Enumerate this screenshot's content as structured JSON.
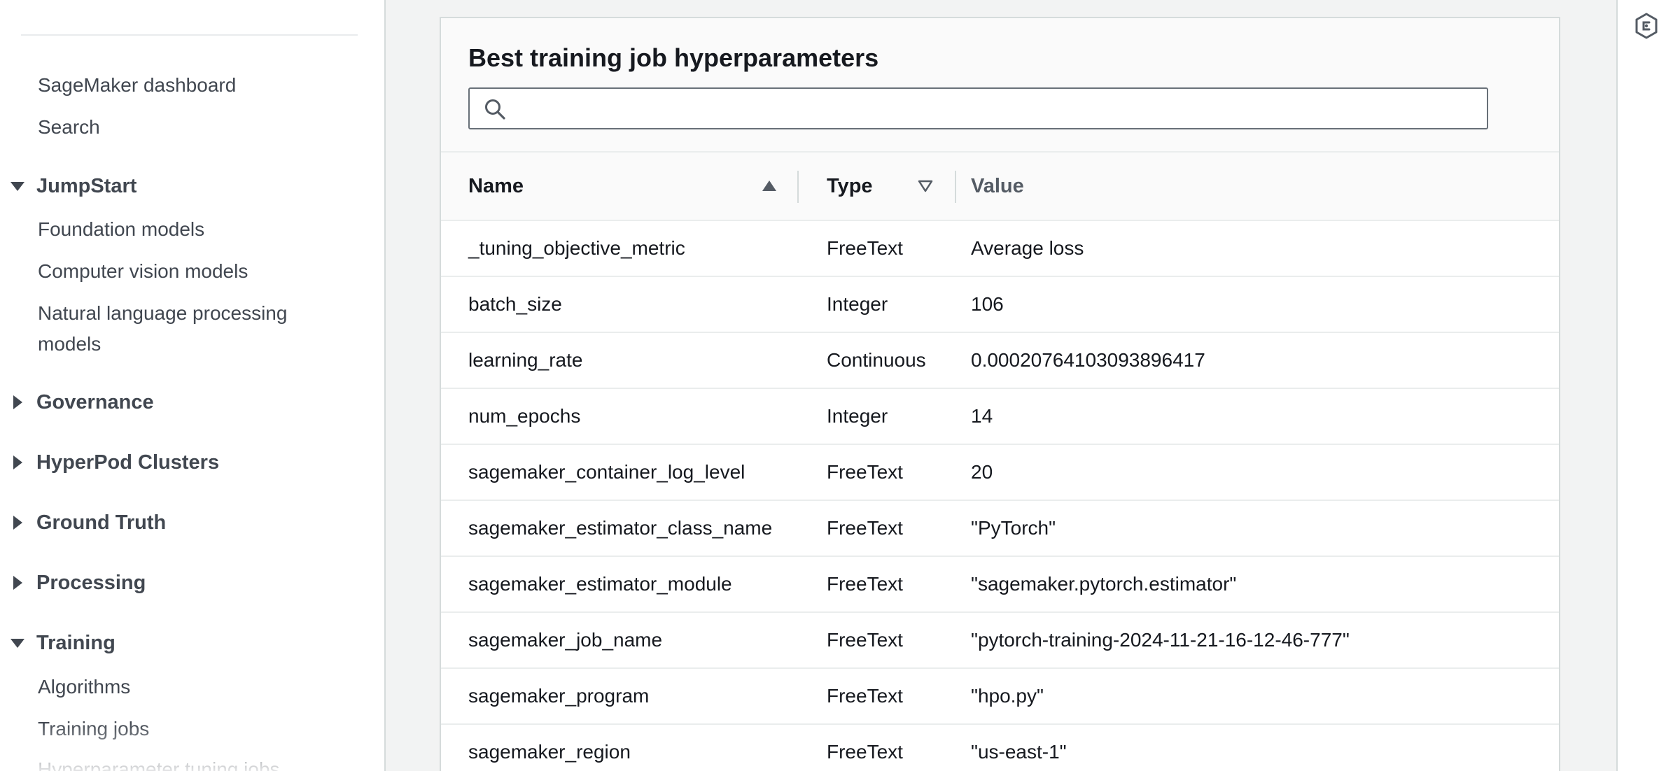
{
  "sidebar": {
    "links_top": [
      {
        "label": "SageMaker dashboard"
      },
      {
        "label": "Search"
      }
    ],
    "jumpstart": {
      "label": "JumpStart",
      "expanded": true,
      "items": [
        "Foundation models",
        "Computer vision models",
        "Natural language processing models"
      ]
    },
    "governance": {
      "label": "Governance",
      "expanded": false
    },
    "hyperpod": {
      "label": "HyperPod Clusters",
      "expanded": false
    },
    "ground_truth": {
      "label": "Ground Truth",
      "expanded": false
    },
    "processing": {
      "label": "Processing",
      "expanded": false
    },
    "training": {
      "label": "Training",
      "expanded": true,
      "items": [
        "Algorithms",
        "Training jobs",
        "Hyperparameter tuning jobs"
      ]
    }
  },
  "panel": {
    "title": "Best training job hyperparameters",
    "search": {
      "value": "",
      "placeholder": ""
    },
    "columns": {
      "name": "Name",
      "type": "Type",
      "value": "Value"
    },
    "sort": {
      "name": "ascending",
      "type": "unsorted"
    },
    "rows": [
      {
        "name": "_tuning_objective_metric",
        "type": "FreeText",
        "value": "Average loss"
      },
      {
        "name": "batch_size",
        "type": "Integer",
        "value": "106"
      },
      {
        "name": "learning_rate",
        "type": "Continuous",
        "value": "0.00020764103093896417"
      },
      {
        "name": "num_epochs",
        "type": "Integer",
        "value": "14"
      },
      {
        "name": "sagemaker_container_log_level",
        "type": "FreeText",
        "value": "20"
      },
      {
        "name": "sagemaker_estimator_class_name",
        "type": "FreeText",
        "value": "\"PyTorch\""
      },
      {
        "name": "sagemaker_estimator_module",
        "type": "FreeText",
        "value": "\"sagemaker.pytorch.estimator\""
      },
      {
        "name": "sagemaker_job_name",
        "type": "FreeText",
        "value": "\"pytorch-training-2024-11-21-16-12-46-777\""
      },
      {
        "name": "sagemaker_program",
        "type": "FreeText",
        "value": "\"hpo.py\""
      },
      {
        "name": "sagemaker_region",
        "type": "FreeText",
        "value": "\"us-east-1\""
      }
    ]
  },
  "colors": {
    "sidebar_text": "#414750",
    "border": "#d5dbdb",
    "header_bg": "#fafafa"
  },
  "icons": {
    "search": "search-icon",
    "sort_asc": "caret-up-filled-icon",
    "sort_none": "caret-down-outline-icon",
    "expanded": "caret-down-icon",
    "collapsed": "caret-right-icon",
    "rail": "hexagon-settings-icon"
  }
}
